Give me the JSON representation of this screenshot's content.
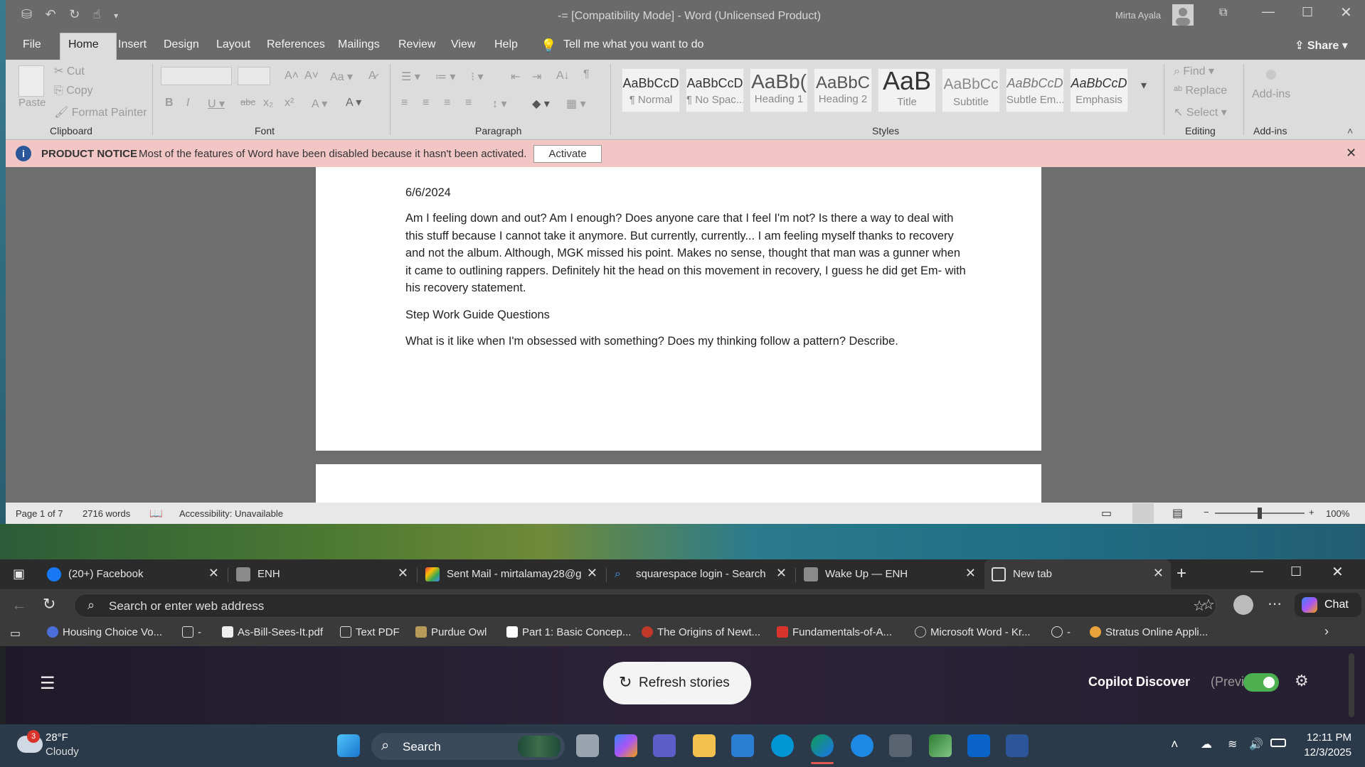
{
  "word": {
    "title": "-= [Compatibility Mode]  -  Word (Unlicensed Product)",
    "user": "Mirta Ayala",
    "tabs": [
      "File",
      "Home",
      "Insert",
      "Design",
      "Layout",
      "References",
      "Mailings",
      "Review",
      "View",
      "Help"
    ],
    "tell_me": "Tell me what you want to do",
    "share": "Share",
    "clipboard": {
      "paste": "Paste",
      "cut": "Cut",
      "copy": "Copy",
      "format_painter": "Format Painter",
      "label": "Clipboard"
    },
    "font_label": "Font",
    "paragraph_label": "Paragraph",
    "styles": [
      {
        "preview": "AaBbCcD",
        "name": "¶ Normal"
      },
      {
        "preview": "AaBbCcD",
        "name": "¶ No Spac..."
      },
      {
        "preview": "AaBb(",
        "name": "Heading 1"
      },
      {
        "preview": "AaBbC",
        "name": "Heading 2"
      },
      {
        "preview": "AaB",
        "name": "Title"
      },
      {
        "preview": "AaBbCc",
        "name": "Subtitle"
      },
      {
        "preview": "AaBbCcD",
        "name": "Subtle Em..."
      },
      {
        "preview": "AaBbCcD",
        "name": "Emphasis"
      }
    ],
    "styles_label": "Styles",
    "editing": {
      "find": "Find",
      "replace": "Replace",
      "select": "Select",
      "label": "Editing"
    },
    "addins": {
      "button": "Add-ins",
      "label": "Add-ins"
    },
    "notice": {
      "title": "PRODUCT NOTICE",
      "message": "Most of the features of Word have been disabled because it hasn't been activated.",
      "button": "Activate"
    },
    "document": {
      "date": "6/6/2024",
      "para1": "Am I feeling down and out? Am I enough? Does anyone care that I feel I'm not? Is there a way to deal with this stuff because I cannot take it anymore. But currently, currently... I am feeling myself thanks to recovery and not the album. Although, MGK missed his point. Makes no sense, thought that man was a gunner when it came to outlining rappers. Definitely hit the head on this movement in recovery, I guess he did get Em- with his recovery statement.",
      "heading": "Step Work Guide Questions",
      "para2": "What is it like when I'm obsessed with something? Does my thinking follow a pattern? Describe."
    },
    "status": {
      "page": "Page 1 of 7",
      "words": "2716 words",
      "accessibility": "Accessibility: Unavailable",
      "zoom": "100%"
    }
  },
  "browser": {
    "tabs": [
      {
        "label": "(20+) Facebook",
        "icon": "facebook-icon"
      },
      {
        "label": "ENH",
        "icon": "page-icon"
      },
      {
        "label": "Sent Mail - mirtalamay28@g",
        "icon": "gmail-icon"
      },
      {
        "label": "squarespace login - Search",
        "icon": "search-icon"
      },
      {
        "label": "Wake Up — ENH",
        "icon": "page-icon"
      },
      {
        "label": "New tab",
        "icon": "newtab-icon"
      }
    ],
    "address_placeholder": "Search or enter web address",
    "chat": "Chat",
    "favorites": [
      "Housing Choice Vo...",
      "-",
      "As-Bill-Sees-It.pdf",
      "Text PDF",
      "Purdue Owl",
      "Part 1: Basic Concep...",
      "The Origins of Newt...",
      "Fundamentals-of-A...",
      "Microsoft Word - Kr...",
      "-",
      "Stratus Online Appli..."
    ],
    "refresh": "Refresh stories",
    "copilot_discover": "Copilot Discover",
    "preview": "(Preview)"
  },
  "taskbar": {
    "weather_badge": "3",
    "temp": "28°F",
    "condition": "Cloudy",
    "search": "Search",
    "time": "12:11 PM",
    "date": "12/3/2025"
  },
  "colors": {
    "notice_bg": "#f3c6c6",
    "toggle_on": "#4caf50",
    "word_accent": "#2b579a"
  }
}
